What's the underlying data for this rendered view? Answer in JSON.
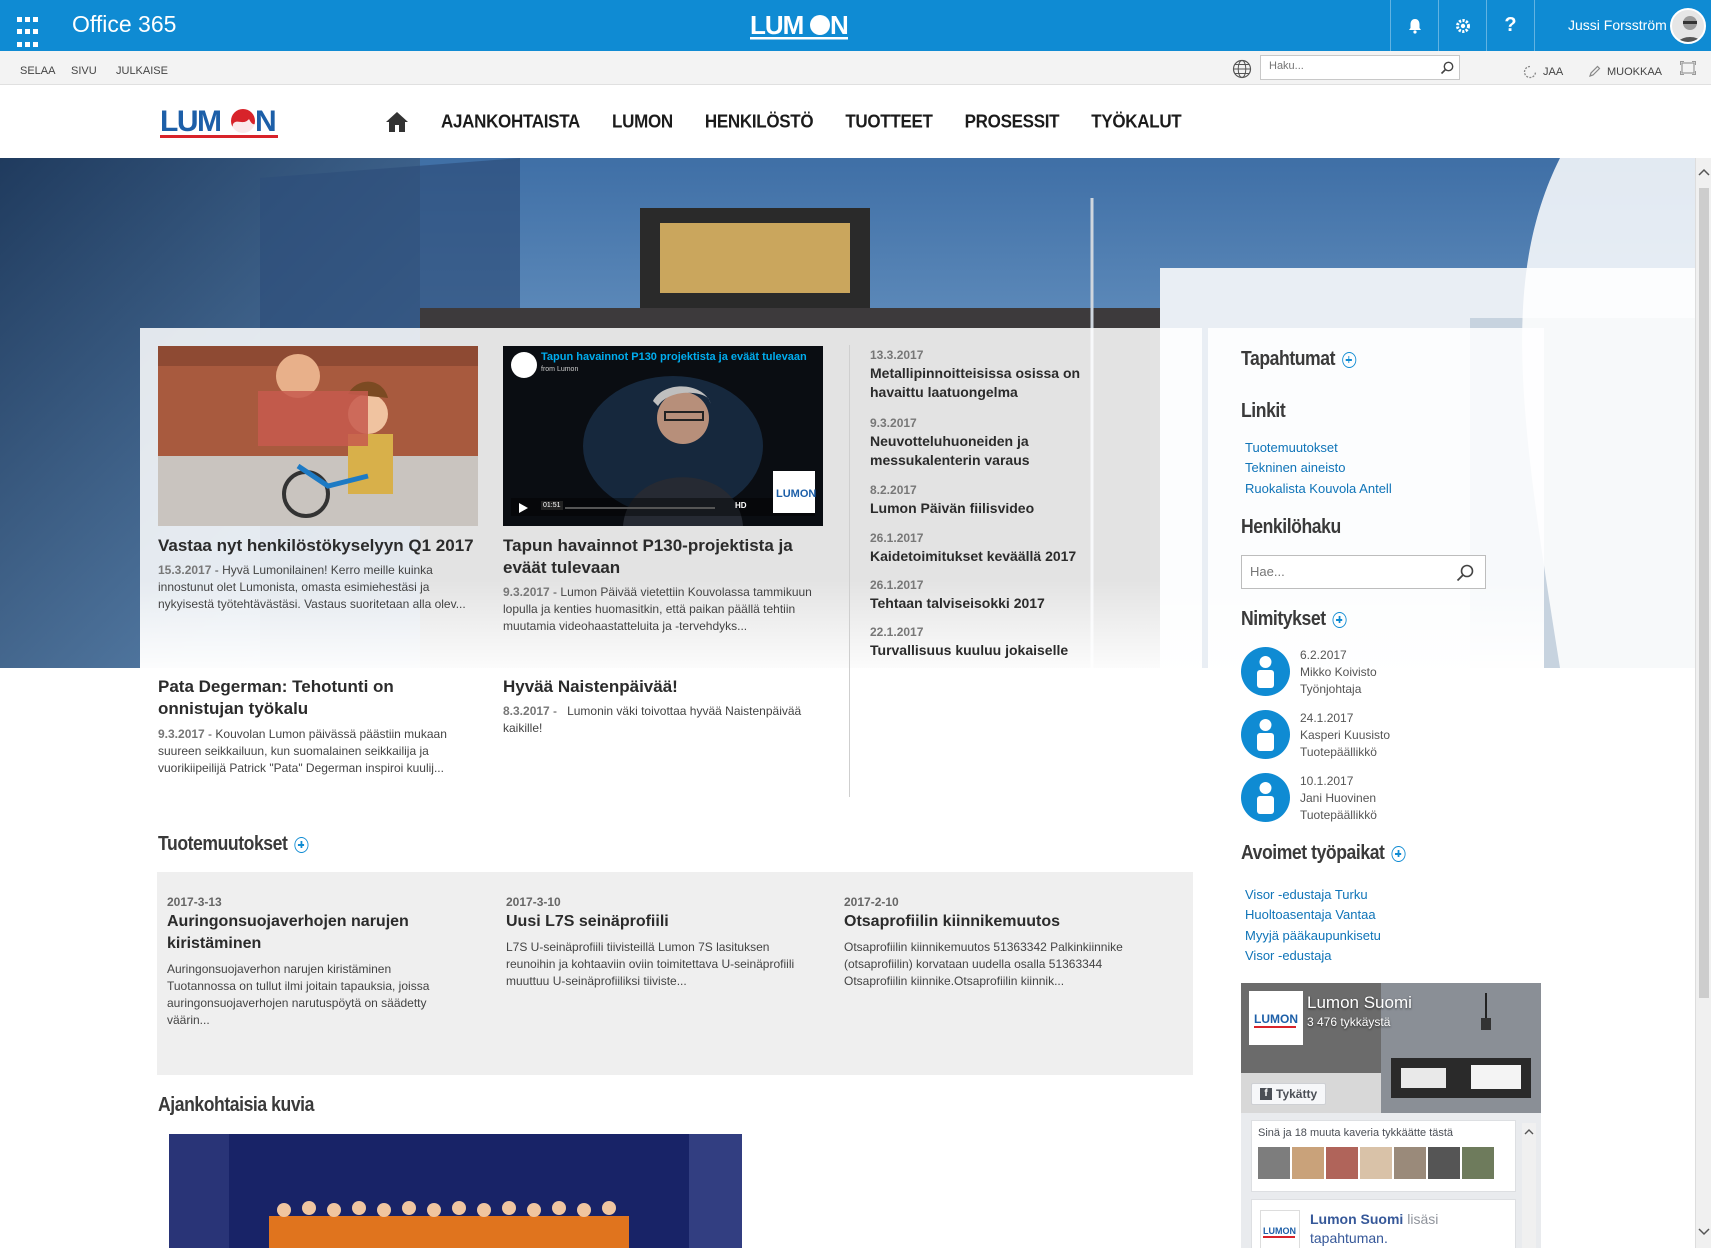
{
  "suite_bar": {
    "title": "Office 365",
    "user_name": "Jussi Forsström",
    "brand": "LUMON"
  },
  "ribbon": {
    "tabs": [
      "SELAA",
      "SIVU",
      "JULKAISE"
    ],
    "search_placeholder": "Haku...",
    "share_label": "JAA",
    "edit_label": "MUOKKAA"
  },
  "site_nav": {
    "items": [
      "AJANKOHTAISTA",
      "LUMON",
      "HENKILÖSTÖ",
      "TUOTTEET",
      "PROSESSIT",
      "TYÖKALUT"
    ]
  },
  "news": [
    {
      "title": "Vastaa nyt henkilöstökyselyyn Q1 2017",
      "date": "15.3.2017",
      "excerpt": "Hyvä Lumonilainen! Kerro meille kuinka innostunut olet Lumonista, omasta esimiehestäsi ja nykyisestä työtehtävästäsi. Vastaus suoritetaan alla olev..."
    },
    {
      "title": "Tapun havainnot P130-projektista ja eväät tulevaan",
      "date": "9.3.2017",
      "excerpt": "Lumon Päivää vietettiin Kouvolassa tammikuun lopulla ja kenties huomasitkin, että paikan päällä tehtiin muutamia videohaastatteluita ja -tervehdyks..."
    },
    {
      "title": "Pata Degerman: Tehotunti on onnistujan työkalu",
      "date": "9.3.2017",
      "excerpt": "Kouvolan Lumon päivässä päästiin mukaan suureen seikkailuun, kun suomalainen seikkailija ja vuorikiipeilijä Patrick \"Pata\" Degerman inspiroi kuulij..."
    },
    {
      "title": "Hyvää Naistenpäivää!",
      "date": "8.3.2017",
      "excerpt": "Lumonin väki toivottaa hyvää Naistenpäivää kaikille!"
    }
  ],
  "video": {
    "title": "Tapun havainnot P130 projektista ja eväät tulevaan",
    "source": "from Lumon",
    "time": "01:51",
    "hd": "HD"
  },
  "news_list": [
    {
      "date": "13.3.2017",
      "title": "Metallipinnoitteisissa osissa on havaittu laatuongelma"
    },
    {
      "date": "9.3.2017",
      "title": "Neuvotteluhuoneiden ja messukalenterin varaus"
    },
    {
      "date": "8.2.2017",
      "title": "Lumon Päivän fiilisvideo"
    },
    {
      "date": "26.1.2017",
      "title": "Kaidetoimitukset keväällä 2017"
    },
    {
      "date": "26.1.2017",
      "title": "Tehtaan talviseisokki 2017"
    },
    {
      "date": "22.1.2017",
      "title": "Turvallisuus kuuluu jokaiselle"
    }
  ],
  "tuotemuutokset": {
    "heading": "Tuotemuutokset",
    "items": [
      {
        "date": "2017-3-13",
        "title": "Auringonsuojaverhojen narujen kiristäminen",
        "body": "Auringonsuojaverhon narujen kiristäminen Tuotannossa on tullut ilmi joitain tapauksia, joissa auringonsuojaverhojen narutuspöytä on säädetty väärin..."
      },
      {
        "date": "2017-3-10",
        "title": "Uusi L7S seinäprofiili",
        "body": "L7S U-seinäprofiili tiivisteillä Lumon 7S lasituksen reunoihin ja kohtaaviin oviin toimitettava U-seinäprofiili muuttuu U-seinäprofiiliksi tiiviste..."
      },
      {
        "date": "2017-2-10",
        "title": "Otsaprofiilin kiinnikemuutos",
        "body": "Otsaprofiilin kiinnikemuutos 51363342 Palkinkiinnike (otsaprofiilin) korvataan uudella osalla 51363344 Otsaprofiilin kiinnike.Otsaprofiilin kiinnik..."
      }
    ]
  },
  "ajankohtaisia_kuvia": {
    "heading": "Ajankohtaisia kuvia"
  },
  "sidebar": {
    "tapahtumat": "Tapahtumat",
    "linkit": {
      "heading": "Linkit",
      "items": [
        "Tuotemuutokset",
        "Tekninen aineisto",
        "Ruokalista Kouvola Antell"
      ]
    },
    "henkilohaku": {
      "heading": "Henkilöhaku",
      "placeholder": "Hae..."
    },
    "nimitykset": {
      "heading": "Nimitykset",
      "items": [
        {
          "date": "6.2.2017",
          "name": "Mikko Koivisto",
          "role": "Työnjohtaja"
        },
        {
          "date": "24.1.2017",
          "name": "Kasperi Kuusisto",
          "role": "Tuotepäällikkö"
        },
        {
          "date": "10.1.2017",
          "name": "Jani Huovinen",
          "role": "Tuotepäällikkö"
        }
      ]
    },
    "avoimet": {
      "heading": "Avoimet työpaikat",
      "items": [
        "Visor -edustaja Turku",
        "Huoltoasentaja Vantaa",
        "Myyjä pääkaupunkisetu",
        "Visor -edustaja"
      ]
    },
    "facebook": {
      "page_name": "Lumon Suomi",
      "likes": "3 476 tykkäystä",
      "like_button": "Tykätty",
      "friends_text": "Sinä ja 18 muuta kaveria tykkäätte tästä",
      "post_author": "Lumon Suomi",
      "post_text_1": "lisäsi",
      "post_text_2": "tapahtuman."
    }
  },
  "colors": {
    "suite_blue": "#0f8bd3",
    "link_blue": "#0f74b8",
    "brand_red": "#d8232a"
  }
}
